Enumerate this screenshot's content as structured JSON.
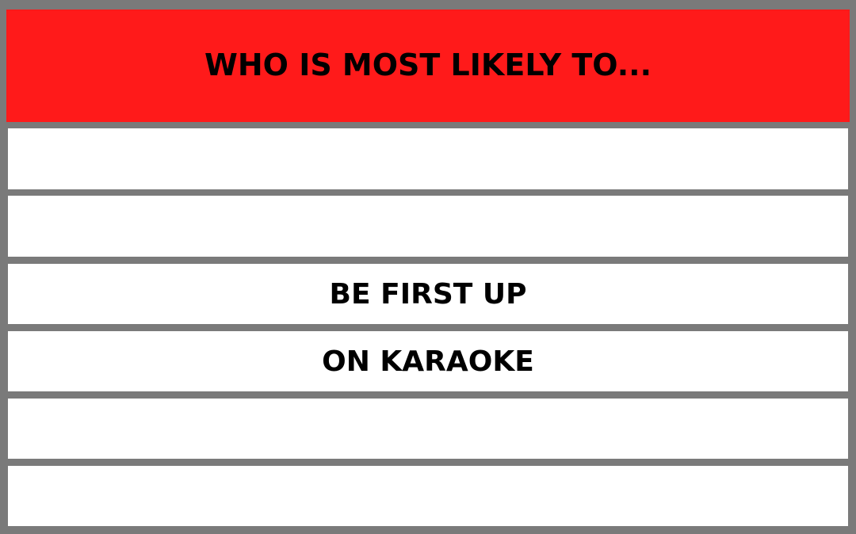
{
  "title": "WHO IS MOST LIKELY TO...",
  "lines": [
    "",
    "",
    "BE FIRST UP",
    "ON KARAOKE",
    "",
    ""
  ],
  "colors": {
    "header_bg": "#ff1a1a",
    "frame": "#7a7a7a",
    "row_bg": "#ffffff",
    "text": "#000000"
  }
}
